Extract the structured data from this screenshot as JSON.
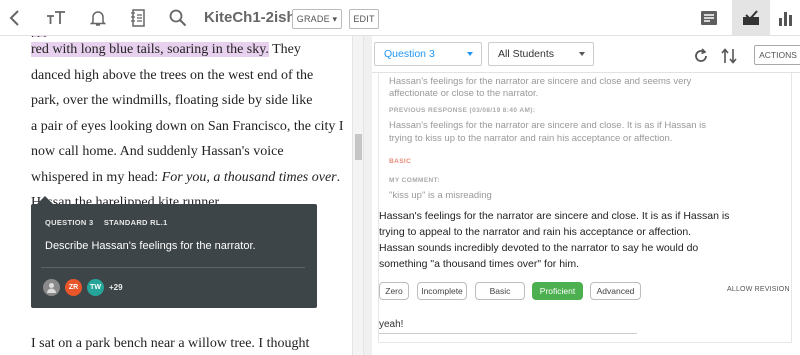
{
  "toolbar": {
    "icons": [
      "back-icon",
      "text-size-icon",
      "bell-icon",
      "notebook-icon",
      "search-icon"
    ],
    "document_title": "KiteCh1-2ish",
    "grade_label": "GRADE",
    "edit_label": "EDIT",
    "right_icons": [
      "responses-icon",
      "checkmark-inbox-icon",
      "bar-chart-icon"
    ]
  },
  "reader": {
    "partial_top_line": "[?]",
    "lines": [
      {
        "text": "red with long blue tails, soaring in the sky.",
        "highlight": true,
        "rest": " They"
      },
      {
        "text": "danced high above the trees on the west end of the"
      },
      {
        "text": "park, over the windmills, floating side by side like"
      },
      {
        "text": "a pair of eyes looking down on San Francisco, the city I"
      },
      {
        "text": "now call home. And suddenly Hassan's voice"
      },
      {
        "pre": "whispered in my head: ",
        "italic": "For you, a thousand times over",
        "post": "."
      },
      {
        "text": "Hassan the harelipped kite runner."
      }
    ],
    "bottom_line": "I sat on a park bench near a willow tree. I thought"
  },
  "popover": {
    "question_label": "QUESTION 3",
    "standard_label": "STANDARD RL.1",
    "question_text": "Describe Hassan's feelings for the narrator.",
    "avatars": [
      {
        "initials": "",
        "color": "#8a8a8a"
      },
      {
        "initials": "ZR",
        "color": "#e8562a"
      },
      {
        "initials": "TW",
        "color": "#26a69a"
      }
    ],
    "more_count": "+29"
  },
  "panel": {
    "question_select": "Question 3",
    "students_select": "All Students",
    "actions_label": "ACTIONS",
    "history_top": [
      "Hassan's feelings for the narrator are sincere and close and seems very",
      "affectionate or close to the narrator."
    ],
    "previous_label": "PREVIOUS RESPONSE (03/08/19 8:40 AM):",
    "previous_response": [
      "Hassan's feelings for the narrator are sincere and close. It is as if Hassan is",
      "trying to kiss up to the narrator and rain his acceptance or affection."
    ],
    "previous_score": "BASIC",
    "my_comment_label": "MY COMMENT:",
    "my_comment": "\"kiss up\" is a misreading",
    "current_response": [
      "Hassan's feelings for the narrator are sincere and close. It is as if Hassan is",
      "trying to appeal to the narrator and rain his acceptance or affection.",
      "Hassan sounds incredibly devoted to the narrator to say he would do",
      "something \"a thousand times over\" for him."
    ],
    "score_buttons": [
      "Zero",
      "Incomplete",
      "Basic",
      "Proficient",
      "Advanced"
    ],
    "active_score": "Proficient",
    "allow_revision": "ALLOW REVISION",
    "comment_value": "yeah!",
    "colors": {
      "accent": "#2196f3",
      "proficient": "#4caf50",
      "basic": "#e88a7a"
    }
  }
}
